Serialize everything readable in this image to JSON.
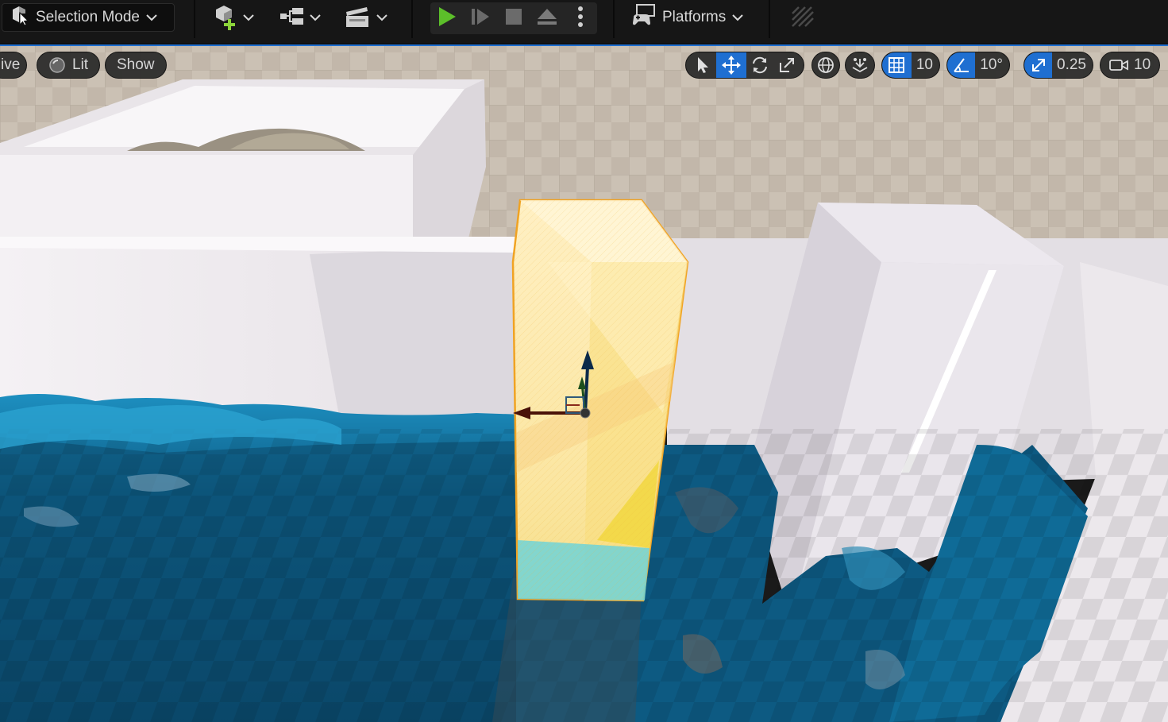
{
  "toolbar": {
    "mode_label": "Selection Mode",
    "platforms_label": "Platforms",
    "icons": {
      "mode": "selection-mode-icon",
      "add_actor": "add-actor-icon",
      "blueprint": "blueprint-icon",
      "cinematics": "cinematics-icon",
      "play": "play-icon",
      "advance_frame": "advance-frame-icon",
      "stop": "stop-icon",
      "eject": "eject-icon",
      "options": "more-options-icon",
      "platforms": "platforms-icon",
      "settings": "settings-icon"
    },
    "colors": {
      "play": "#5cbf2a",
      "add": "#8cd43a"
    }
  },
  "viewport": {
    "view_mode_partial": "ive",
    "lit_label": "Lit",
    "show_label": "Show",
    "grid_snap_value": "10",
    "rotation_snap_value": "10°",
    "scale_snap_value": "0.25",
    "camera_speed_value": "10",
    "icons": {
      "select": "select-arrow-icon",
      "translate": "translate-icon",
      "rotate": "rotate-icon",
      "scale": "scale-icon",
      "world_local": "world-globe-icon",
      "surface_snap": "surface-snap-icon",
      "grid_snap": "grid-snap-icon",
      "rotation_snap": "angle-icon",
      "scale_snap": "scale-snap-icon",
      "camera_speed": "camera-icon"
    },
    "colors": {
      "accent": "#1f6fd1",
      "selection": "#f0a323",
      "water": "#0d5f8c"
    }
  }
}
